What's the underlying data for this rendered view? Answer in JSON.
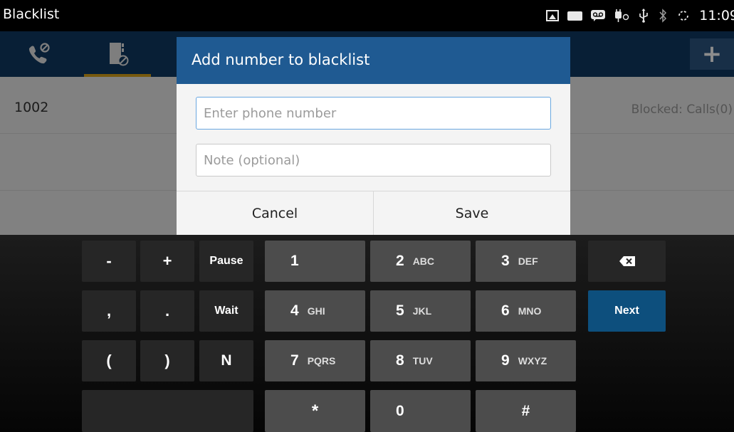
{
  "status_bar": {
    "title": "Blacklist",
    "time": "11:09",
    "icons": [
      "image-icon",
      "ftp-icon",
      "voicemail-icon",
      "plug-icon",
      "usb-icon",
      "bluetooth-icon",
      "sync-icon"
    ],
    "ftp_label": "FTP"
  },
  "toolbar": {
    "tabs": [
      {
        "name": "call-blocked-icon"
      },
      {
        "name": "contact-blocked-icon"
      }
    ],
    "add_label": "+"
  },
  "list": {
    "items": [
      {
        "number": "1002",
        "status": "Blocked: Calls(0)"
      }
    ]
  },
  "dialog": {
    "title": "Add number to blacklist",
    "phone_placeholder": "Enter phone number",
    "note_placeholder": "Note (optional)",
    "cancel_label": "Cancel",
    "save_label": "Save"
  },
  "keyboard": {
    "minus": "-",
    "plus": "+",
    "pause": "Pause",
    "comma": ",",
    "period": ".",
    "wait": "Wait",
    "lparen": "(",
    "rparen": ")",
    "n": "N",
    "next": "Next",
    "star": "*",
    "zero": "0",
    "hash": "#",
    "keys": [
      {
        "digit": "1",
        "letters": ""
      },
      {
        "digit": "2",
        "letters": "ABC"
      },
      {
        "digit": "3",
        "letters": "DEF"
      },
      {
        "digit": "4",
        "letters": "GHI"
      },
      {
        "digit": "5",
        "letters": "JKL"
      },
      {
        "digit": "6",
        "letters": "MNO"
      },
      {
        "digit": "7",
        "letters": "PQRS"
      },
      {
        "digit": "8",
        "letters": "TUV"
      },
      {
        "digit": "9",
        "letters": "WXYZ"
      }
    ]
  },
  "colors": {
    "toolbar": "#0f3963",
    "dialog_header": "#1f5a92",
    "tab_indicator": "#d9a21b",
    "next_key": "#0d4f7d"
  }
}
